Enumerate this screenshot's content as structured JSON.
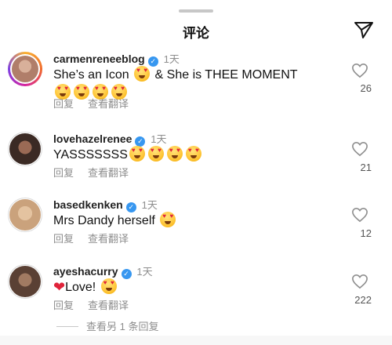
{
  "header": {
    "title": "评论",
    "share_icon": "send-icon"
  },
  "comments": [
    {
      "username": "carmenreneeblog",
      "time": "1天",
      "text_before": "She’s an Icon ",
      "text_mid": " & She is THEE MOMENT ",
      "reply_label": "回复",
      "translate_label": "查看翻译",
      "likes": "26",
      "avatar_color": "#b07e6a"
    },
    {
      "username": "lovehazelrenee",
      "time": "1天",
      "text_before": "YASSSSSSS",
      "reply_label": "回复",
      "translate_label": "查看翻译",
      "likes": "21",
      "avatar_color": "#3b2a24"
    },
    {
      "username": "basedkenken",
      "time": "1天",
      "text_before": "Mrs Dandy herself ",
      "reply_label": "回复",
      "translate_label": "查看翻译",
      "likes": "12",
      "avatar_color": "#caa27c"
    },
    {
      "username": "ayeshacurry",
      "time": "1天",
      "text_before": "Love! ",
      "reply_label": "回复",
      "translate_label": "查看翻译",
      "likes": "222",
      "avatar_color": "#5a4034"
    }
  ],
  "view_more": "查看另 1 条回复"
}
